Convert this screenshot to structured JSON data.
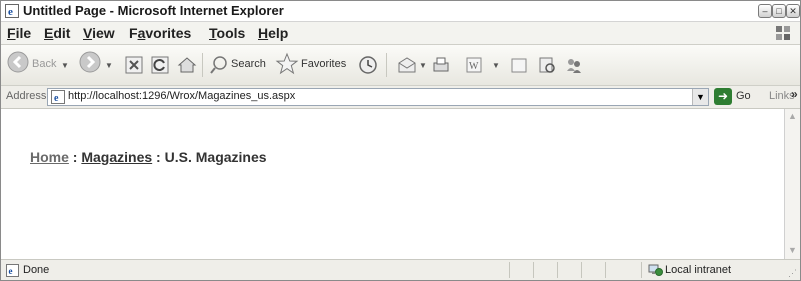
{
  "window": {
    "title": "Untitled Page - Microsoft Internet Explorer"
  },
  "menu": {
    "items": [
      {
        "label": "File",
        "key": "F",
        "rest": "ile"
      },
      {
        "label": "Edit",
        "key": "E",
        "rest": "dit"
      },
      {
        "label": "View",
        "key": "V",
        "rest": "iew"
      },
      {
        "label": "Favorites",
        "pre": "F",
        "key": "a",
        "rest": "vorites"
      },
      {
        "label": "Tools",
        "key": "T",
        "rest": "ools"
      },
      {
        "label": "Help",
        "key": "H",
        "rest": "elp"
      }
    ]
  },
  "toolbar": {
    "back_label": "Back",
    "search_label": "Search",
    "favorites_label": "Favorites"
  },
  "address": {
    "label": "Address",
    "url": "http://localhost:1296/Wrox/Magazines_us.aspx",
    "go_label": "Go",
    "links_label": "Links",
    "links_chevron": "»"
  },
  "breadcrumb": {
    "home": "Home",
    "separator1": " : ",
    "magazines": "Magazines",
    "separator2": " : ",
    "current": "U.S. Magazines"
  },
  "status": {
    "text": "Done",
    "zone": "Local intranet"
  },
  "icons": {
    "ie": "ie-icon",
    "back": "back-arrow-icon",
    "forward": "forward-arrow-icon",
    "stop": "stop-icon",
    "refresh": "refresh-icon",
    "home": "home-icon",
    "search": "search-icon",
    "favorites": "favorites-star-icon",
    "history": "history-icon",
    "mail": "mail-icon",
    "print": "print-icon",
    "edit": "edit-icon",
    "discuss": "discuss-icon",
    "research": "research-icon",
    "messenger": "messenger-icon",
    "go": "go-arrow-icon",
    "zone": "local-intranet-icon"
  },
  "colors": {
    "go_green": "#2e7d32",
    "back_green": "#3b8e3e",
    "window_bg": "#ecebe6"
  }
}
